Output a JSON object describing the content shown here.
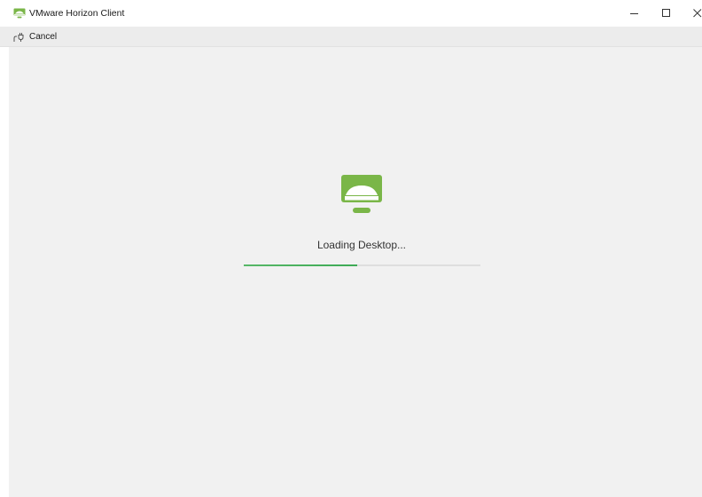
{
  "window": {
    "title": "VMware Horizon Client",
    "app_icon": "horizon-desktop-icon",
    "controls": {
      "minimize_icon": "minimize-icon",
      "maximize_icon": "maximize-icon",
      "close_icon": "close-icon"
    }
  },
  "toolbar": {
    "cancel_label": "Cancel",
    "cancel_icon": "disconnect-plug-icon"
  },
  "main": {
    "icon": "horizon-desktop-icon",
    "status_text": "Loading Desktop...",
    "progress": 0.48
  },
  "colors": {
    "accent_green": "#7ab648",
    "progress_green": "#4cb05e",
    "background": "#f1f1f1",
    "toolbar": "#ececec"
  }
}
